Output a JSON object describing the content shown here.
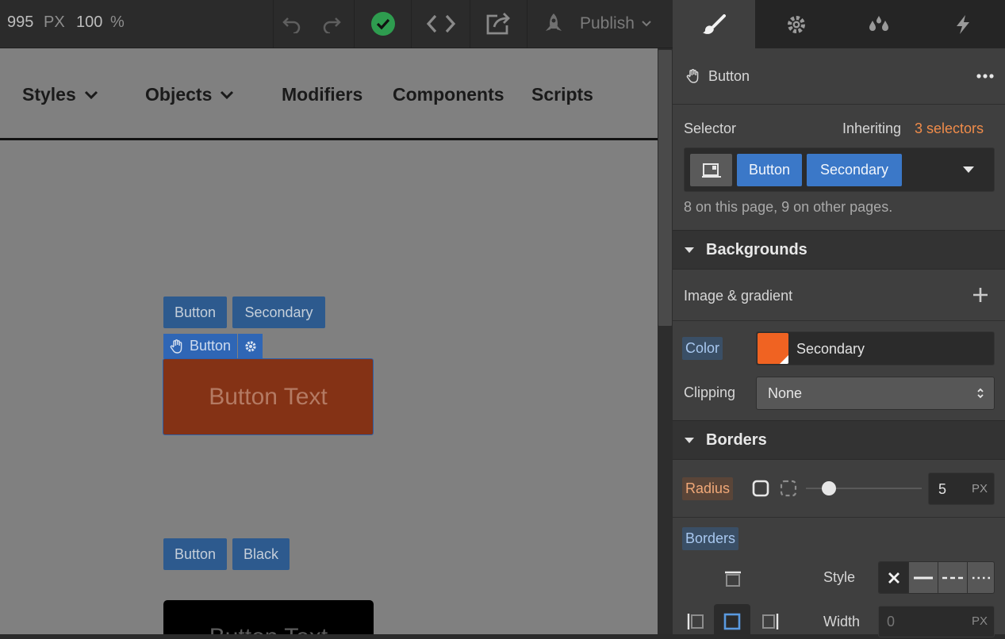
{
  "topbar": {
    "width_value": "995",
    "width_unit": "PX",
    "zoom_value": "100",
    "zoom_unit": "%",
    "publish_label": "Publish",
    "icons": [
      "undo-icon",
      "redo-icon",
      "check-circle-icon",
      "code-icon",
      "export-icon",
      "rocket-icon",
      "chevron-down-icon"
    ],
    "check_color": "#2e9c4f"
  },
  "canvas": {
    "nav": [
      {
        "label": "Styles",
        "has_dropdown": true
      },
      {
        "label": "Objects",
        "has_dropdown": true
      },
      {
        "label": "Modifiers",
        "has_dropdown": false
      },
      {
        "label": "Components",
        "has_dropdown": false
      },
      {
        "label": "Scripts",
        "has_dropdown": false
      }
    ],
    "tags1": [
      "Button",
      "Secondary"
    ],
    "selected_element_label": "Button",
    "orange_button_text": "Button Text",
    "tags2": [
      "Button",
      "Black"
    ],
    "black_button_text": "Button Text"
  },
  "panel": {
    "tabs": [
      "brush-icon",
      "gear-icon",
      "drops-icon",
      "lightning-icon"
    ],
    "element_name": "Button",
    "selector_label": "Selector",
    "inheriting_text": "Inheriting",
    "inheriting_count": "3 selectors",
    "selector_chips": [
      "Button",
      "Secondary"
    ],
    "usage_text": "8 on this page, 9 on other pages.",
    "backgrounds": {
      "title": "Backgrounds",
      "image_gradient_label": "Image & gradient",
      "color_label": "Color",
      "color_value": "Secondary",
      "color_swatch": "#f06322",
      "clipping_label": "Clipping",
      "clipping_value": "None"
    },
    "borders": {
      "title": "Borders",
      "radius_label": "Radius",
      "radius_value": "5",
      "radius_unit": "PX",
      "radius_slider_level": 0.2,
      "borders_label": "Borders",
      "style_label": "Style",
      "width_label": "Width",
      "width_placeholder": "0",
      "width_unit": "PX"
    },
    "accent_blue": "#3b78c8",
    "accent_orange": "#f08c4a"
  }
}
